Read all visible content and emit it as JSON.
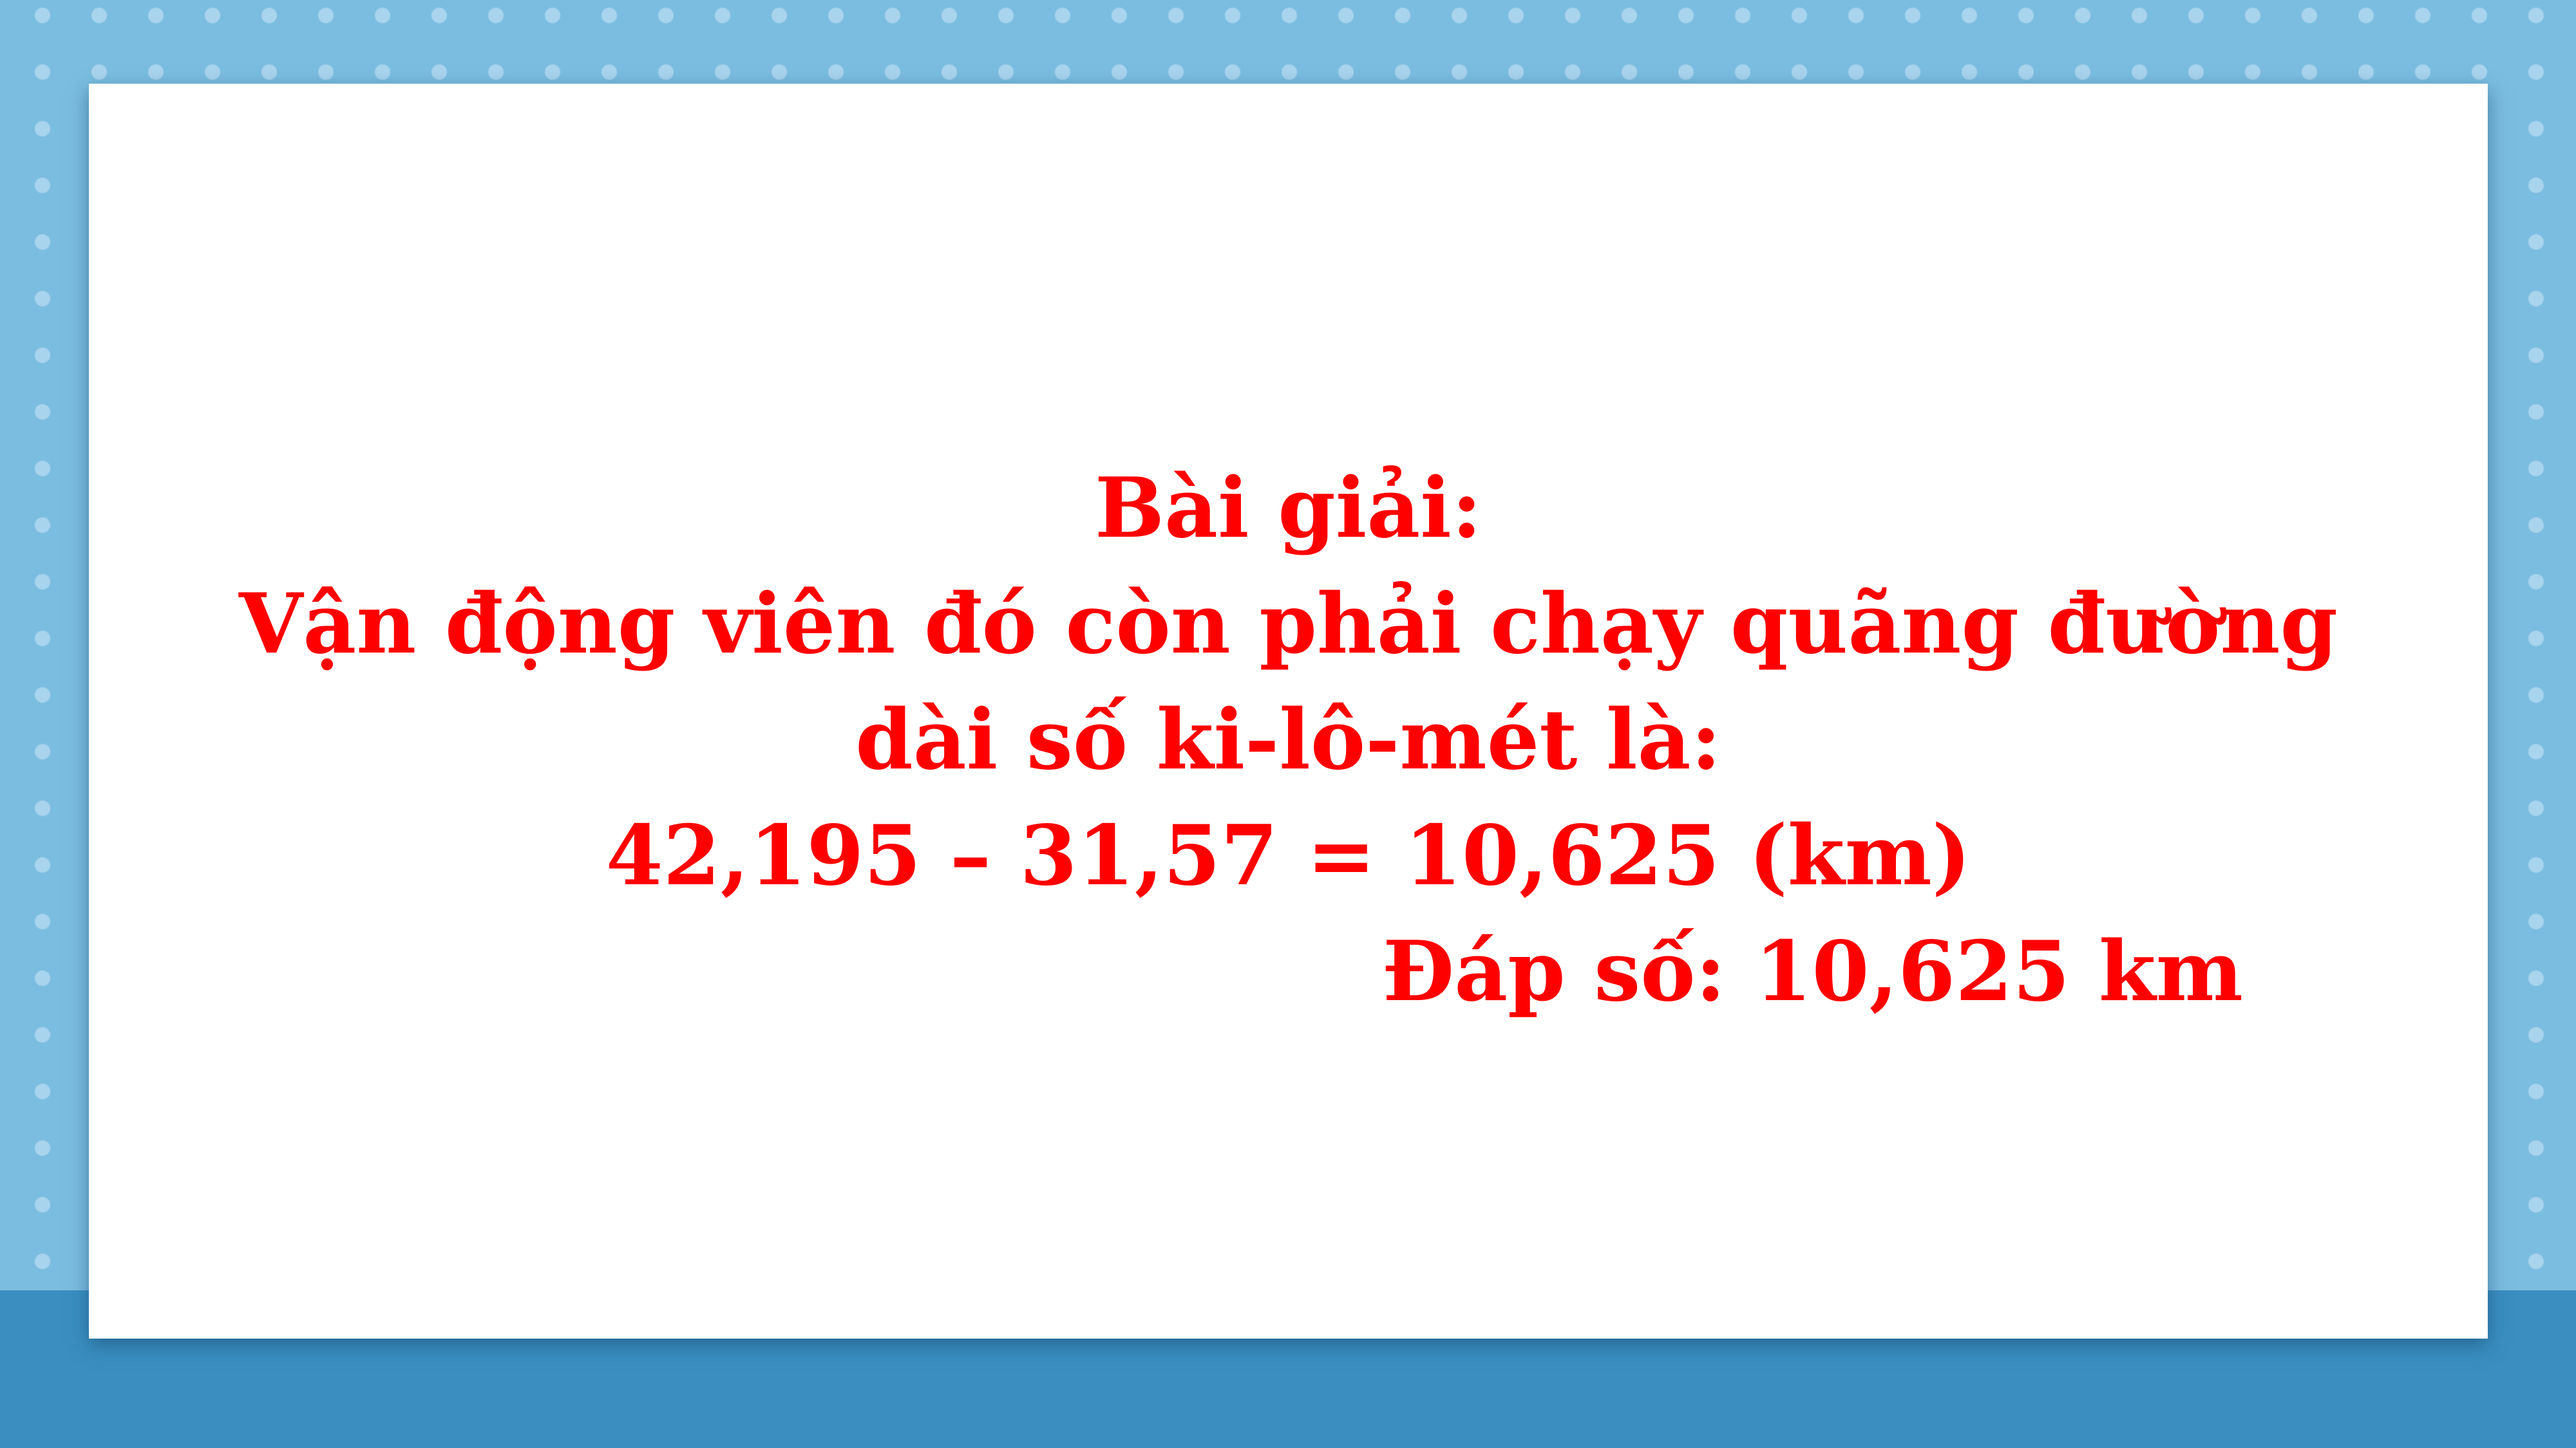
{
  "solution": {
    "heading": "Bài giải:",
    "sentence_line1": "Vận động viên đó còn phải chạy quãng đường",
    "sentence_line2": "dài số ki-lô-mét là:",
    "calculation": "42,195 – 31,57 = 10,625 (km)",
    "answer": "Đáp số: 10,625 km"
  },
  "colors": {
    "text": "#ff0000",
    "background": "#7bbde0",
    "band": "#3a8fc0",
    "card": "#ffffff"
  }
}
